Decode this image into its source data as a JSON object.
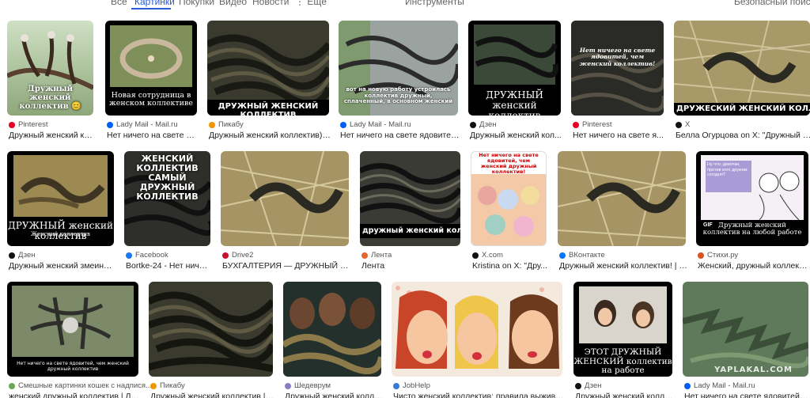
{
  "tabs": [
    {
      "label": "Все",
      "active": false
    },
    {
      "label": "Картинки",
      "active": true
    },
    {
      "label": "Покупки",
      "active": false
    },
    {
      "label": "Видео",
      "active": false
    },
    {
      "label": "Новости",
      "active": false
    },
    {
      "label": "⋮ Ещё",
      "active": false
    }
  ],
  "tools_label": "Инструменты",
  "safe_search_label": "Безопасный поиск",
  "results": [
    {
      "source": "Pinterest",
      "title": "Дружный женский кол...",
      "favicon_color": "#e60023",
      "caption": "Дружный женский коллектив 😊"
    },
    {
      "source": "Lady Mail - Mail.ru",
      "title": "Нет ничего на свете ядов...",
      "favicon_color": "#005ff9",
      "caption": "Новая сотрудница в женском коллективе"
    },
    {
      "source": "Пикабу",
      "title": "Дружный женский коллектив) | ...",
      "favicon_color": "#f29500",
      "caption": "ДРУЖНЫЙ ЖЕНСКИЙ КОЛЛЕКТИВ"
    },
    {
      "source": "Lady Mail - Mail.ru",
      "title": "Нет ничего на свете ядовитей,...",
      "favicon_color": "#005ff9",
      "caption": "вот на новую работу устроилась коллектив дружный, сплаченный, в основном женский"
    },
    {
      "source": "Дзен",
      "title": "Дружный женский кол...",
      "favicon_color": "#111111",
      "caption": "ДРУЖНЫЙ женский коллектив"
    },
    {
      "source": "Pinterest",
      "title": "Нет ничего на свете я...",
      "favicon_color": "#e60023",
      "caption": "Нет ничего на свете ядовитей, чем женский коллектив!"
    },
    {
      "source": "X",
      "title": "Белла Огурцова on X: \"Дружный же...",
      "favicon_color": "#111111",
      "caption": "ДРУЖЕСКИЙ ЖЕНСКИЙ КОЛЛЕКТИВ"
    },
    {
      "source": "Дзен",
      "title": "Дружный женский змеины...",
      "favicon_color": "#111111",
      "caption": "ДРУЖНЫЙ женский коллектив"
    },
    {
      "source": "Facebook",
      "title": "Bortke-24 - Нет ничег...",
      "favicon_color": "#1877f2",
      "caption": "ЖЕНСКИЙ КОЛЛЕКТИВ САМЫЙ ДРУЖНЫЙ КОЛЛЕКТИВ"
    },
    {
      "source": "Drive2",
      "title": "БУХГАЛТЕРИЯ — ДРУЖНЫЙ Ж...",
      "favicon_color": "#c8102e",
      "caption": ""
    },
    {
      "source": "Лента",
      "title": "Лента",
      "favicon_color": "#e8632b",
      "caption": "дружный женский коллектив"
    },
    {
      "source": "X.com",
      "title": "Kristina on X: \"Дру...",
      "favicon_color": "#111111",
      "caption": "Нет ничего на свете ядовитей, чем женский дружный коллектив!"
    },
    {
      "source": "ВКонтакте",
      "title": "Дружный женский коллектив! | М...",
      "favicon_color": "#0077ff",
      "caption": ""
    },
    {
      "source": "Стихи.ру",
      "title": "Женский, дружный коллектив...",
      "favicon_color": "#d9531e",
      "caption": "Дружный женский коллектив на любой работе"
    },
    {
      "source": "Смешные картинки кошек с надпися...",
      "title": "женский дружный коллектив | Ло...",
      "favicon_color": "#6aa84f",
      "caption": "Нет ничего на свете ядовитей, чем женский дружный коллектив"
    },
    {
      "source": "Пикабу",
      "title": "Дружный женский коллектив | П...",
      "favicon_color": "#f29500",
      "caption": ""
    },
    {
      "source": "Шедеврум",
      "title": "Дружный женский колле...",
      "favicon_color": "#8e7cc3",
      "caption": ""
    },
    {
      "source": "JobHelp",
      "title": "Чисто женский коллектив: правила выжива...",
      "favicon_color": "#3c78d8",
      "caption": ""
    },
    {
      "source": "Дзен",
      "title": "Дружный женский колле...",
      "favicon_color": "#111111",
      "caption": "ЭТОТ ДРУЖНЫЙ ЖЕНСКИЙ коллектив на работе"
    },
    {
      "source": "Lady Mail - Mail.ru",
      "title": "Нет ничего на свете ядовитей, ...",
      "favicon_color": "#005ff9",
      "caption": "YAPLAKAL.COM"
    }
  ],
  "thumb_extra": {
    "r8_sub": "Женский коллектив",
    "r14_bubble": "Ну что, девочки, против кого дружим сегодня?",
    "r14_gif": "GIF"
  }
}
